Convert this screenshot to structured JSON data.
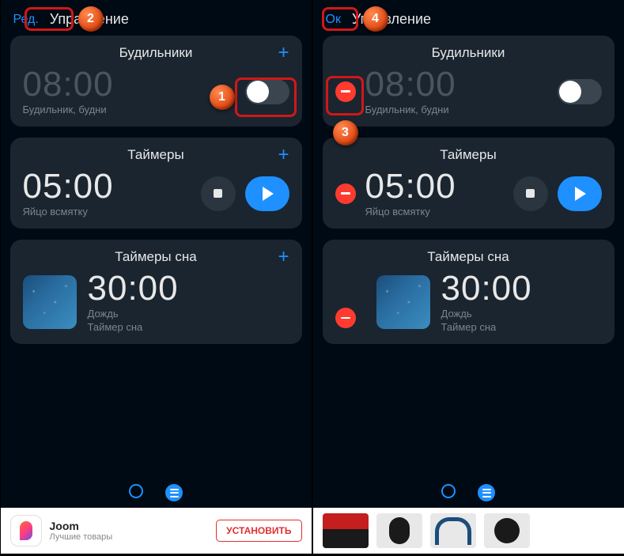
{
  "left": {
    "header": {
      "button": "Ред.",
      "title": "Управление"
    },
    "alarms": {
      "title": "Будильники",
      "time": "08:00",
      "label": "Будильник, будни"
    },
    "timers": {
      "title": "Таймеры",
      "time": "05:00",
      "label": "Яйцо всмятку"
    },
    "sleep": {
      "title": "Таймеры сна",
      "time": "30:00",
      "label": "Дождь",
      "sub": "Таймер сна"
    },
    "ad": {
      "title": "Joom",
      "sub": "Лучшие товары",
      "button": "УСТАНОВИТЬ"
    }
  },
  "right": {
    "header": {
      "button": "Ок",
      "title": "Управление"
    },
    "alarms": {
      "title": "Будильники",
      "time": "08:00",
      "label": "Будильник, будни"
    },
    "timers": {
      "title": "Таймеры",
      "time": "05:00",
      "label": "Яйцо всмятку"
    },
    "sleep": {
      "title": "Таймеры сна",
      "time": "30:00",
      "label": "Дождь",
      "sub": "Таймер сна"
    }
  },
  "badges": {
    "n1": "1",
    "n2": "2",
    "n3": "3",
    "n4": "4"
  }
}
